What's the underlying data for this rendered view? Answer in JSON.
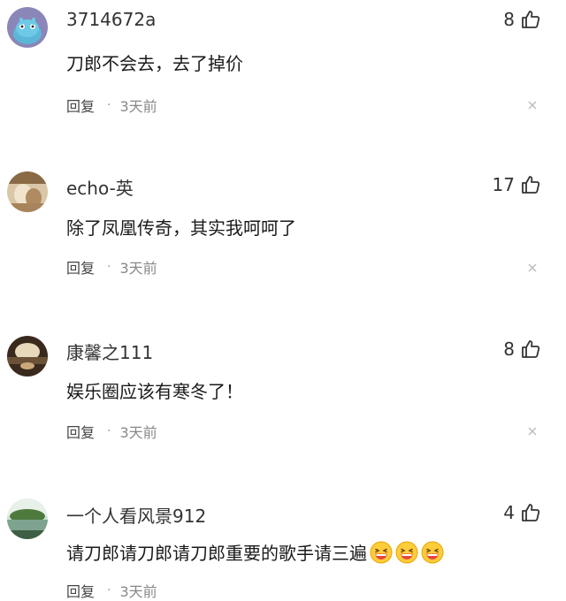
{
  "comments": [
    {
      "username": "3714672a",
      "likes": "8",
      "text": "刀郎不会去，去了掉价",
      "reply_label": "回复",
      "separator": "·",
      "time": "3天前",
      "avatar_icon": "blue-cartoon-avatar-icon"
    },
    {
      "username": "echo-英",
      "likes": "17",
      "text": "除了凤凰传奇，其实我呵呵了",
      "reply_label": "回复",
      "separator": "·",
      "time": "3天前",
      "avatar_icon": "photo-avatar-icon"
    },
    {
      "username": "康馨之111",
      "likes": "8",
      "text": "娱乐圈应该有寒冬了！",
      "reply_label": "回复",
      "separator": "·",
      "time": "3天前",
      "avatar_icon": "landscape-avatar-icon"
    },
    {
      "username": "一个人看风景912",
      "likes": "4",
      "text": "请刀郎请刀郎请刀郎重要的歌手请三遍",
      "emojis": [
        "grin-emoji",
        "grin-emoji",
        "grin-emoji"
      ],
      "reply_label": "回复",
      "separator": "·",
      "time": "3天前",
      "avatar_icon": "lake-avatar-icon"
    }
  ]
}
